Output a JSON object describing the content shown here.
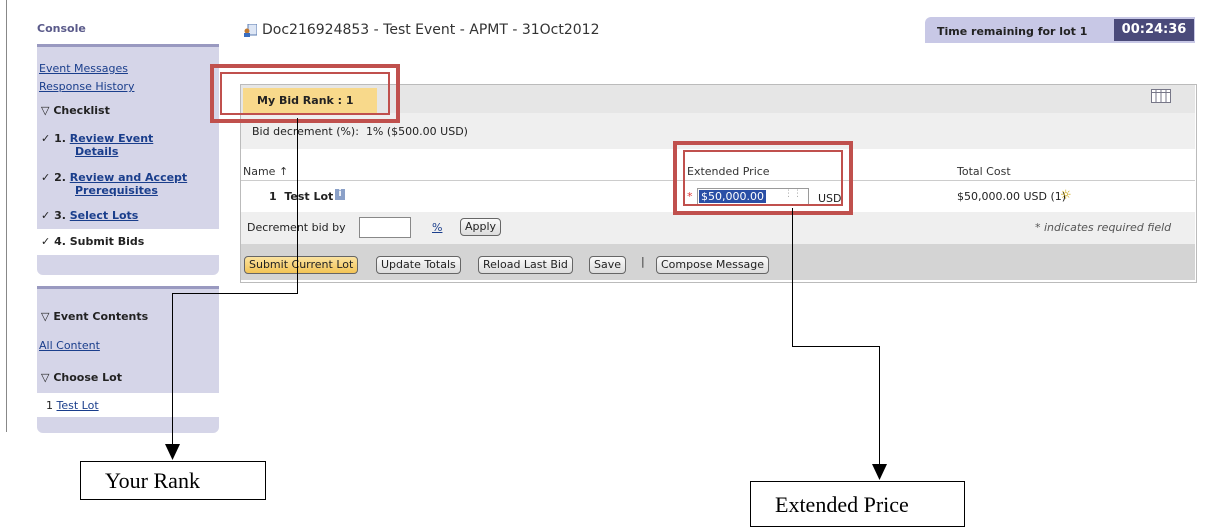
{
  "sidebar": {
    "console_title": "Console",
    "links": [
      "Event Messages",
      "Response History"
    ],
    "checklist_label": "Checklist",
    "steps": [
      {
        "num": "1.",
        "line1": "Review Event",
        "line2": "Details"
      },
      {
        "num": "2.",
        "line1": "Review and Accept",
        "line2": "Prerequisites"
      },
      {
        "num": "3.",
        "line1": "Select Lots",
        "line2": ""
      },
      {
        "num": "4.",
        "line1": "Submit Bids",
        "line2": ""
      }
    ],
    "event_contents_label": "Event Contents",
    "all_content_link": "All Content",
    "choose_lot_label": "Choose Lot",
    "lot_item_num": "1",
    "lot_item_link": "Test Lot"
  },
  "header": {
    "doc_title": "Doc216924853 - Test Event - APMT - 31Oct2012",
    "time_label": "Time remaining for lot 1",
    "time_value": "00:24:36"
  },
  "main": {
    "rank_tab": "My Bid Rank : 1",
    "bid_decrement_label": "Bid decrement (%):",
    "bid_decrement_value": "1% ($500.00 USD)",
    "columns": {
      "name": "Name ↑",
      "extended_price": "Extended Price",
      "total_cost": "Total Cost"
    },
    "lot_row": {
      "num": "1",
      "name": "Test Lot",
      "price_value": "$50,000.00",
      "currency": "USD",
      "total": "$50,000.00 USD (1)"
    },
    "decrement_by_label": "Decrement bid by",
    "pct_link": "%",
    "apply_button": "Apply",
    "required_note": "* indicates required field",
    "buttons": {
      "submit": "Submit Current Lot",
      "update": "Update Totals",
      "reload": "Reload Last Bid",
      "save": "Save",
      "separator": "|",
      "compose": "Compose Message"
    }
  },
  "annotations": {
    "rank_callout": "Your Rank",
    "price_callout": "Extended Price",
    "color": "#c0504d"
  }
}
